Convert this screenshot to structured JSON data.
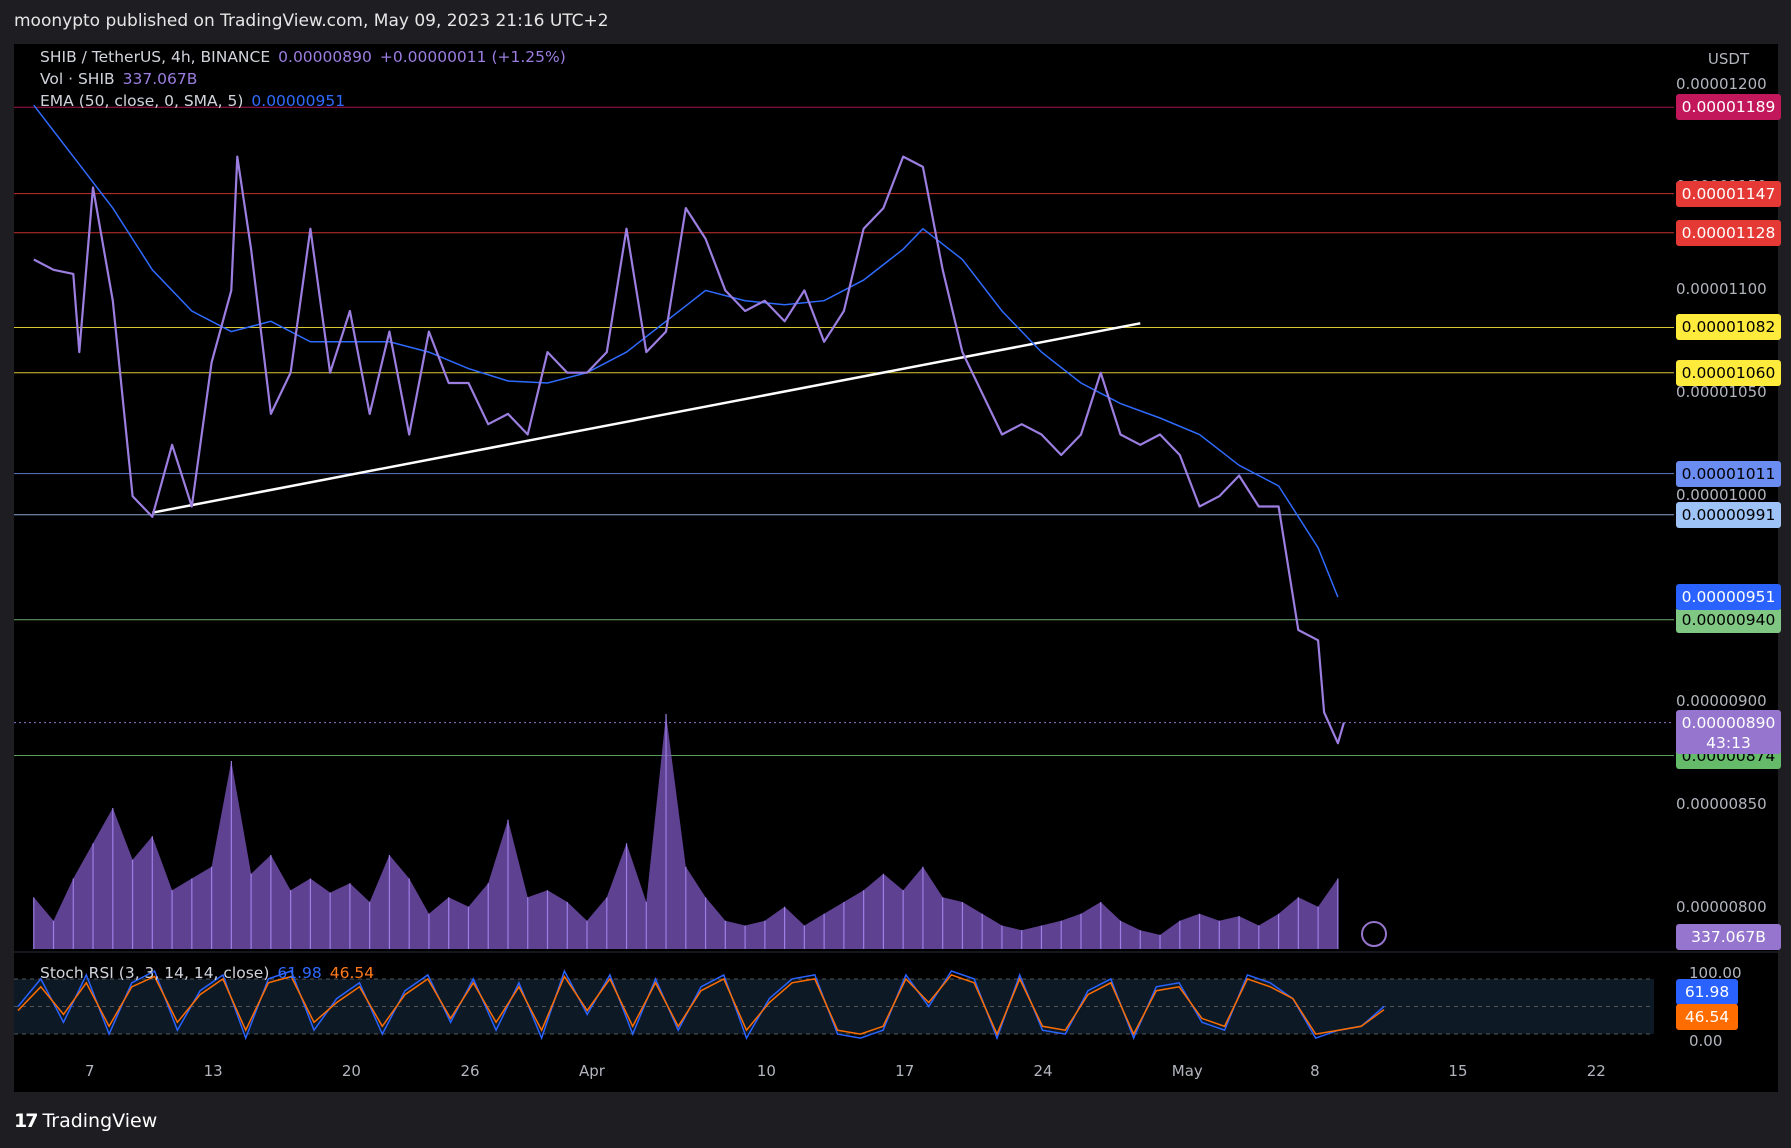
{
  "header": {
    "published": "moonypto published on TradingView.com, May 09, 2023 21:16 UTC+2"
  },
  "legend": {
    "symbol": "SHIB / TetherUS, 4h, BINANCE",
    "price": "0.00000890",
    "change": "+0.00000011 (+1.25%)",
    "vol_name": "Vol · SHIB",
    "vol_value": "337.067B",
    "ema_name": "EMA (50, close, 0, SMA, 5)",
    "ema_value": "0.00000951",
    "stoch_name": "Stoch RSI (3, 3, 14, 14, close)",
    "stoch_k": "61.98",
    "stoch_d": "46.54"
  },
  "axis": {
    "currency": "USDT",
    "price_ticks": [
      "0.00001200",
      "0.00001150",
      "0.00001100",
      "0.00001050",
      "0.00001000",
      "0.00000900",
      "0.00000850",
      "0.00000800"
    ],
    "rsi_ticks": [
      "100.00",
      "0.00"
    ],
    "x_ticks": [
      "7",
      "13",
      "20",
      "26",
      "Apr",
      "10",
      "17",
      "24",
      "May",
      "8",
      "15",
      "22"
    ],
    "countdown": "43:13"
  },
  "levels": [
    {
      "label": "0.00001189",
      "value": 1.189e-05,
      "color": "#c2185b",
      "text": "#ffffff"
    },
    {
      "label": "0.00001147",
      "value": 1.147e-05,
      "color": "#e53935",
      "text": "#ffffff"
    },
    {
      "label": "0.00001128",
      "value": 1.128e-05,
      "color": "#e53935",
      "text": "#ffffff"
    },
    {
      "label": "0.00001082",
      "value": 1.082e-05,
      "color": "#ffeb3b",
      "text": "#000000"
    },
    {
      "label": "0.00001060",
      "value": 1.06e-05,
      "color": "#ffeb3b",
      "text": "#000000"
    },
    {
      "label": "0.00001011",
      "value": 1.011e-05,
      "color": "#6b8cf0",
      "text": "#000000"
    },
    {
      "label": "0.00000991",
      "value": 9.91e-06,
      "color": "#9ec3f7",
      "text": "#000000"
    },
    {
      "label": "0.00000940",
      "value": 9.4e-06,
      "color": "#81c784",
      "text": "#000000"
    },
    {
      "label": "0.00000874",
      "value": 8.74e-06,
      "color": "#66bb6a",
      "text": "#000000"
    }
  ],
  "badges": {
    "ema": {
      "label": "0.00000951",
      "value": 9.51e-06,
      "color": "#2962ff",
      "text": "#ffffff"
    },
    "last": {
      "label": "0.00000890",
      "value": 8.9e-06,
      "color": "#9575cd",
      "text": "#ffffff"
    },
    "vol": {
      "label": "337.067B",
      "color": "#9575cd",
      "text": "#ffffff"
    },
    "k": {
      "label": "61.98",
      "color": "#2962ff",
      "text": "#ffffff"
    },
    "d": {
      "label": "46.54",
      "color": "#ff6d00",
      "text": "#ffffff"
    }
  },
  "colors": {
    "price": "#9b7ee0",
    "ema": "#2f6bff",
    "volume": "#7e57c2",
    "trendline": "#ffffff",
    "stoch_k": "#2962ff",
    "stoch_d": "#ff6d00"
  },
  "chart_data": {
    "type": "line",
    "title": "SHIB / TetherUS, 4h, BINANCE",
    "ylabel": "USDT",
    "ylim": [
      7.8e-06,
      1.21e-05
    ],
    "price_series": [
      [
        "2023-03-04",
        1.115e-05
      ],
      [
        "2023-03-05",
        1.11e-05
      ],
      [
        "2023-03-06",
        1.108e-05
      ],
      [
        "2023-03-06",
        1.07e-05
      ],
      [
        "2023-03-07",
        1.15e-05
      ],
      [
        "2023-03-08",
        1.095e-05
      ],
      [
        "2023-03-09",
        1e-05
      ],
      [
        "2023-03-10",
        9.9e-06
      ],
      [
        "2023-03-11",
        1.025e-05
      ],
      [
        "2023-03-12",
        9.95e-06
      ],
      [
        "2023-03-13",
        1.065e-05
      ],
      [
        "2023-03-14",
        1.1e-05
      ],
      [
        "2023-03-14",
        1.165e-05
      ],
      [
        "2023-03-15",
        1.12e-05
      ],
      [
        "2023-03-16",
        1.04e-05
      ],
      [
        "2023-03-17",
        1.06e-05
      ],
      [
        "2023-03-18",
        1.13e-05
      ],
      [
        "2023-03-19",
        1.06e-05
      ],
      [
        "2023-03-20",
        1.09e-05
      ],
      [
        "2023-03-21",
        1.04e-05
      ],
      [
        "2023-03-22",
        1.08e-05
      ],
      [
        "2023-03-23",
        1.03e-05
      ],
      [
        "2023-03-24",
        1.08e-05
      ],
      [
        "2023-03-25",
        1.055e-05
      ],
      [
        "2023-03-26",
        1.055e-05
      ],
      [
        "2023-03-27",
        1.035e-05
      ],
      [
        "2023-03-28",
        1.04e-05
      ],
      [
        "2023-03-29",
        1.03e-05
      ],
      [
        "2023-03-30",
        1.07e-05
      ],
      [
        "2023-03-31",
        1.06e-05
      ],
      [
        "2023-04-01",
        1.06e-05
      ],
      [
        "2023-04-02",
        1.07e-05
      ],
      [
        "2023-04-03",
        1.13e-05
      ],
      [
        "2023-04-04",
        1.07e-05
      ],
      [
        "2023-04-05",
        1.08e-05
      ],
      [
        "2023-04-06",
        1.14e-05
      ],
      [
        "2023-04-07",
        1.125e-05
      ],
      [
        "2023-04-08",
        1.1e-05
      ],
      [
        "2023-04-09",
        1.09e-05
      ],
      [
        "2023-04-10",
        1.095e-05
      ],
      [
        "2023-04-11",
        1.085e-05
      ],
      [
        "2023-04-12",
        1.1e-05
      ],
      [
        "2023-04-13",
        1.075e-05
      ],
      [
        "2023-04-14",
        1.09e-05
      ],
      [
        "2023-04-15",
        1.13e-05
      ],
      [
        "2023-04-16",
        1.14e-05
      ],
      [
        "2023-04-17",
        1.165e-05
      ],
      [
        "2023-04-18",
        1.16e-05
      ],
      [
        "2023-04-19",
        1.11e-05
      ],
      [
        "2023-04-20",
        1.07e-05
      ],
      [
        "2023-04-21",
        1.05e-05
      ],
      [
        "2023-04-22",
        1.03e-05
      ],
      [
        "2023-04-23",
        1.035e-05
      ],
      [
        "2023-04-24",
        1.03e-05
      ],
      [
        "2023-04-25",
        1.02e-05
      ],
      [
        "2023-04-26",
        1.03e-05
      ],
      [
        "2023-04-27",
        1.06e-05
      ],
      [
        "2023-04-28",
        1.03e-05
      ],
      [
        "2023-04-29",
        1.025e-05
      ],
      [
        "2023-04-30",
        1.03e-05
      ],
      [
        "2023-05-01",
        1.02e-05
      ],
      [
        "2023-05-02",
        9.95e-06
      ],
      [
        "2023-05-03",
        1e-05
      ],
      [
        "2023-05-04",
        1.01e-05
      ],
      [
        "2023-05-05",
        9.95e-06
      ],
      [
        "2023-05-06",
        9.95e-06
      ],
      [
        "2023-05-07",
        9.35e-06
      ],
      [
        "2023-05-08",
        9.3e-06
      ],
      [
        "2023-05-08",
        8.95e-06
      ],
      [
        "2023-05-09",
        8.8e-06
      ],
      [
        "2023-05-09",
        8.9e-06
      ]
    ],
    "ema_series": [
      [
        "2023-03-04",
        1.19e-05
      ],
      [
        "2023-03-06",
        1.165e-05
      ],
      [
        "2023-03-08",
        1.14e-05
      ],
      [
        "2023-03-10",
        1.11e-05
      ],
      [
        "2023-03-12",
        1.09e-05
      ],
      [
        "2023-03-14",
        1.08e-05
      ],
      [
        "2023-03-16",
        1.085e-05
      ],
      [
        "2023-03-18",
        1.075e-05
      ],
      [
        "2023-03-20",
        1.075e-05
      ],
      [
        "2023-03-22",
        1.075e-05
      ],
      [
        "2023-03-24",
        1.07e-05
      ],
      [
        "2023-03-26",
        1.062e-05
      ],
      [
        "2023-03-28",
        1.056e-05
      ],
      [
        "2023-03-30",
        1.055e-05
      ],
      [
        "2023-04-01",
        1.06e-05
      ],
      [
        "2023-04-03",
        1.07e-05
      ],
      [
        "2023-04-05",
        1.085e-05
      ],
      [
        "2023-04-07",
        1.1e-05
      ],
      [
        "2023-04-09",
        1.095e-05
      ],
      [
        "2023-04-11",
        1.093e-05
      ],
      [
        "2023-04-13",
        1.095e-05
      ],
      [
        "2023-04-15",
        1.105e-05
      ],
      [
        "2023-04-17",
        1.12e-05
      ],
      [
        "2023-04-18",
        1.13e-05
      ],
      [
        "2023-04-20",
        1.115e-05
      ],
      [
        "2023-04-22",
        1.09e-05
      ],
      [
        "2023-04-24",
        1.07e-05
      ],
      [
        "2023-04-26",
        1.055e-05
      ],
      [
        "2023-04-28",
        1.045e-05
      ],
      [
        "2023-04-30",
        1.038e-05
      ],
      [
        "2023-05-02",
        1.03e-05
      ],
      [
        "2023-05-04",
        1.015e-05
      ],
      [
        "2023-05-06",
        1.005e-05
      ],
      [
        "2023-05-08",
        9.75e-06
      ],
      [
        "2023-05-09",
        9.51e-06
      ]
    ],
    "trendline": [
      [
        "2023-03-10",
        9.92e-06
      ],
      [
        "2023-04-29",
        1.084e-05
      ]
    ],
    "volume_series": [
      [
        "2023-03-04",
        0.22
      ],
      [
        "2023-03-05",
        0.12
      ],
      [
        "2023-03-06",
        0.3
      ],
      [
        "2023-03-07",
        0.45
      ],
      [
        "2023-03-08",
        0.6
      ],
      [
        "2023-03-09",
        0.38
      ],
      [
        "2023-03-10",
        0.48
      ],
      [
        "2023-03-11",
        0.25
      ],
      [
        "2023-03-12",
        0.3
      ],
      [
        "2023-03-13",
        0.35
      ],
      [
        "2023-03-14",
        0.8
      ],
      [
        "2023-03-15",
        0.32
      ],
      [
        "2023-03-16",
        0.4
      ],
      [
        "2023-03-17",
        0.25
      ],
      [
        "2023-03-18",
        0.3
      ],
      [
        "2023-03-19",
        0.24
      ],
      [
        "2023-03-20",
        0.28
      ],
      [
        "2023-03-21",
        0.2
      ],
      [
        "2023-03-22",
        0.4
      ],
      [
        "2023-03-23",
        0.3
      ],
      [
        "2023-03-24",
        0.15
      ],
      [
        "2023-03-25",
        0.22
      ],
      [
        "2023-03-26",
        0.18
      ],
      [
        "2023-03-27",
        0.28
      ],
      [
        "2023-03-28",
        0.55
      ],
      [
        "2023-03-29",
        0.22
      ],
      [
        "2023-03-30",
        0.25
      ],
      [
        "2023-03-31",
        0.2
      ],
      [
        "2023-04-01",
        0.12
      ],
      [
        "2023-04-02",
        0.22
      ],
      [
        "2023-04-03",
        0.45
      ],
      [
        "2023-04-04",
        0.2
      ],
      [
        "2023-04-05",
        1.0
      ],
      [
        "2023-04-06",
        0.35
      ],
      [
        "2023-04-07",
        0.22
      ],
      [
        "2023-04-08",
        0.12
      ],
      [
        "2023-04-09",
        0.1
      ],
      [
        "2023-04-10",
        0.12
      ],
      [
        "2023-04-11",
        0.18
      ],
      [
        "2023-04-12",
        0.1
      ],
      [
        "2023-04-13",
        0.15
      ],
      [
        "2023-04-14",
        0.2
      ],
      [
        "2023-04-15",
        0.25
      ],
      [
        "2023-04-16",
        0.32
      ],
      [
        "2023-04-17",
        0.25
      ],
      [
        "2023-04-18",
        0.35
      ],
      [
        "2023-04-19",
        0.22
      ],
      [
        "2023-04-20",
        0.2
      ],
      [
        "2023-04-21",
        0.15
      ],
      [
        "2023-04-22",
        0.1
      ],
      [
        "2023-04-23",
        0.08
      ],
      [
        "2023-04-24",
        0.1
      ],
      [
        "2023-04-25",
        0.12
      ],
      [
        "2023-04-26",
        0.15
      ],
      [
        "2023-04-27",
        0.2
      ],
      [
        "2023-04-28",
        0.12
      ],
      [
        "2023-04-29",
        0.08
      ],
      [
        "2023-04-30",
        0.06
      ],
      [
        "2023-05-01",
        0.12
      ],
      [
        "2023-05-02",
        0.15
      ],
      [
        "2023-05-03",
        0.12
      ],
      [
        "2023-05-04",
        0.14
      ],
      [
        "2023-05-05",
        0.1
      ],
      [
        "2023-05-06",
        0.15
      ],
      [
        "2023-05-07",
        0.22
      ],
      [
        "2023-05-08",
        0.18
      ],
      [
        "2023-05-09",
        0.3
      ]
    ],
    "stoch_rsi_k": [
      50,
      85,
      30,
      90,
      15,
      80,
      95,
      20,
      70,
      90,
      10,
      85,
      95,
      20,
      60,
      80,
      15,
      70,
      90,
      30,
      85,
      20,
      80,
      10,
      95,
      40,
      90,
      15,
      85,
      20,
      75,
      90,
      10,
      60,
      85,
      90,
      15,
      10,
      20,
      90,
      50,
      95,
      85,
      10,
      90,
      20,
      15,
      70,
      85,
      10,
      75,
      80,
      30,
      20,
      90,
      80,
      60,
      10,
      20,
      25,
      50
    ],
    "stoch_rsi_d": [
      45,
      75,
      40,
      80,
      25,
      75,
      88,
      30,
      65,
      85,
      20,
      80,
      88,
      30,
      55,
      75,
      25,
      65,
      85,
      35,
      80,
      30,
      75,
      20,
      88,
      45,
      85,
      25,
      80,
      25,
      70,
      85,
      20,
      55,
      80,
      85,
      20,
      15,
      25,
      85,
      55,
      90,
      80,
      15,
      85,
      25,
      20,
      65,
      80,
      15,
      70,
      75,
      35,
      25,
      85,
      75,
      60,
      15,
      20,
      25,
      46
    ],
    "stoch_ylim": [
      0,
      100
    ],
    "x_range": [
      "2023-03-03",
      "2023-05-25"
    ]
  },
  "footer": {
    "brand": "TradingView"
  }
}
